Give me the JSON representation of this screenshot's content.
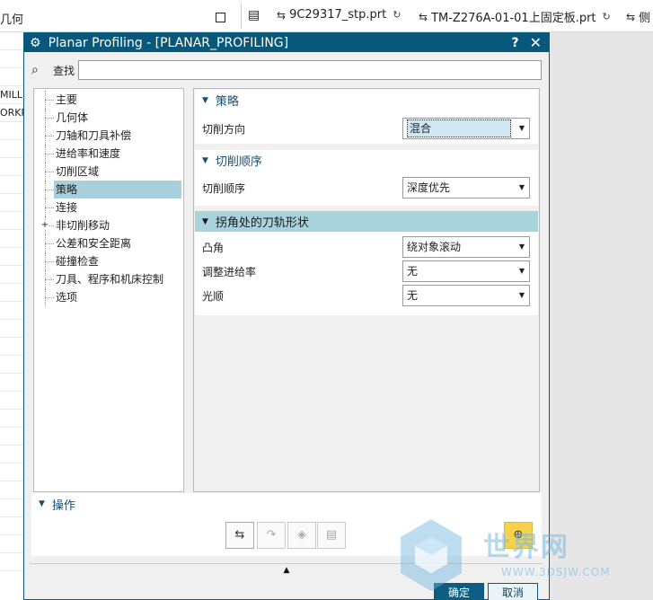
{
  "topbar": {
    "left_label": "几何",
    "tabs": [
      {
        "label": "9C29317_stp.prt"
      },
      {
        "label": "TM-Z276A-01-01上固定板.prt"
      },
      {
        "label": "侧"
      }
    ]
  },
  "bg_left_rows": [
    "MILL",
    "ORKP"
  ],
  "dialog": {
    "title": "Planar Profiling - [PLANAR_PROFILING]",
    "help": "?",
    "close": "✕",
    "search_label": "查找",
    "search_value": ""
  },
  "tree": {
    "items": [
      {
        "label": "主要"
      },
      {
        "label": "几何体"
      },
      {
        "label": "刀轴和刀具补偿"
      },
      {
        "label": "进给率和速度"
      },
      {
        "label": "切削区域"
      },
      {
        "label": "策略",
        "selected": true
      },
      {
        "label": "连接"
      },
      {
        "label": "非切削移动",
        "expandable": true
      },
      {
        "label": "公差和安全距离"
      },
      {
        "label": "碰撞检查"
      },
      {
        "label": "刀具、程序和机床控制"
      },
      {
        "label": "选项"
      }
    ]
  },
  "groups": {
    "strategy": {
      "title": "策略",
      "cut_direction_label": "切削方向",
      "cut_direction_value": "混合"
    },
    "cut_order": {
      "title": "切削顺序",
      "cut_order_label": "切削顺序",
      "cut_order_value": "深度优先"
    },
    "corner": {
      "title": "拐角处的刀轨形状",
      "convex_label": "凸角",
      "convex_value": "绕对象滚动",
      "feed_label": "调整进给率",
      "feed_value": "无",
      "smooth_label": "光顺",
      "smooth_value": "无"
    }
  },
  "operations": {
    "title": "操作"
  },
  "footer": {
    "ok": "确定",
    "cancel": "取消"
  },
  "watermark": {
    "text": "世界网",
    "url": "WWW.3DSJW.COM"
  },
  "colors": {
    "titlebar": "#07587b",
    "selection": "#a7d0dc",
    "group_highlight": "#a8d3dc",
    "group_title": "#1a4e70",
    "ok_button": "#0c5f82"
  }
}
